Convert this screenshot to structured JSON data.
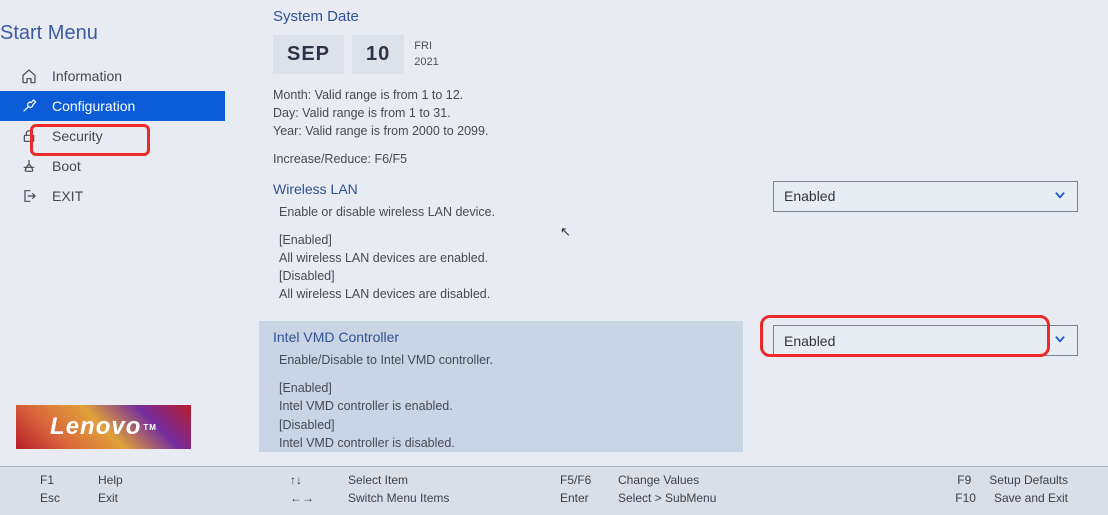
{
  "sidebar": {
    "title": "Start Menu",
    "items": [
      {
        "label": "Information",
        "icon": "home-icon"
      },
      {
        "label": "Configuration",
        "icon": "wrench-icon"
      },
      {
        "label": "Security",
        "icon": "lock-icon"
      },
      {
        "label": "Boot",
        "icon": "boot-icon"
      },
      {
        "label": "EXIT",
        "icon": "exit-icon"
      }
    ]
  },
  "date": {
    "title": "System Date",
    "month": "SEP",
    "day": "10",
    "weekday": "FRI",
    "year": "2021",
    "help_month": "Month: Valid range is from 1 to 12.",
    "help_day": "Day: Valid range is from 1 to 31.",
    "help_year": "Year: Valid range is from 2000 to 2099.",
    "help_incdec": "Increase/Reduce: F6/F5"
  },
  "wireless": {
    "title": "Wireless LAN",
    "desc": "Enable or disable wireless LAN device.",
    "en_label": "[Enabled]",
    "en_text": "All wireless LAN devices are enabled.",
    "dis_label": "[Disabled]",
    "dis_text": "All wireless LAN devices are disabled.",
    "value": "Enabled"
  },
  "vmd": {
    "title": "Intel VMD Controller",
    "desc": "Enable/Disable to Intel VMD controller.",
    "en_label": "[Enabled]",
    "en_text": "Intel VMD controller is enabled.",
    "dis_label": "[Disabled]",
    "dis_text": "Intel VMD controller is disabled.",
    "value": "Enabled"
  },
  "logo": "Lenovo",
  "footer": {
    "f1_k": "F1",
    "f1_v": "Help",
    "esc_k": "Esc",
    "esc_v": "Exit",
    "ud_k": "↑↓",
    "ud_v": "Select Item",
    "lr_k": "←→",
    "lr_v": "Switch Menu Items",
    "f56_k": "F5/F6",
    "f56_v": "Change Values",
    "ent_k": "Enter",
    "ent_v": "Select > SubMenu",
    "f9_k": "F9",
    "f9_v": "Setup Defaults",
    "f10_k": "F10",
    "f10_v": "Save and Exit"
  }
}
